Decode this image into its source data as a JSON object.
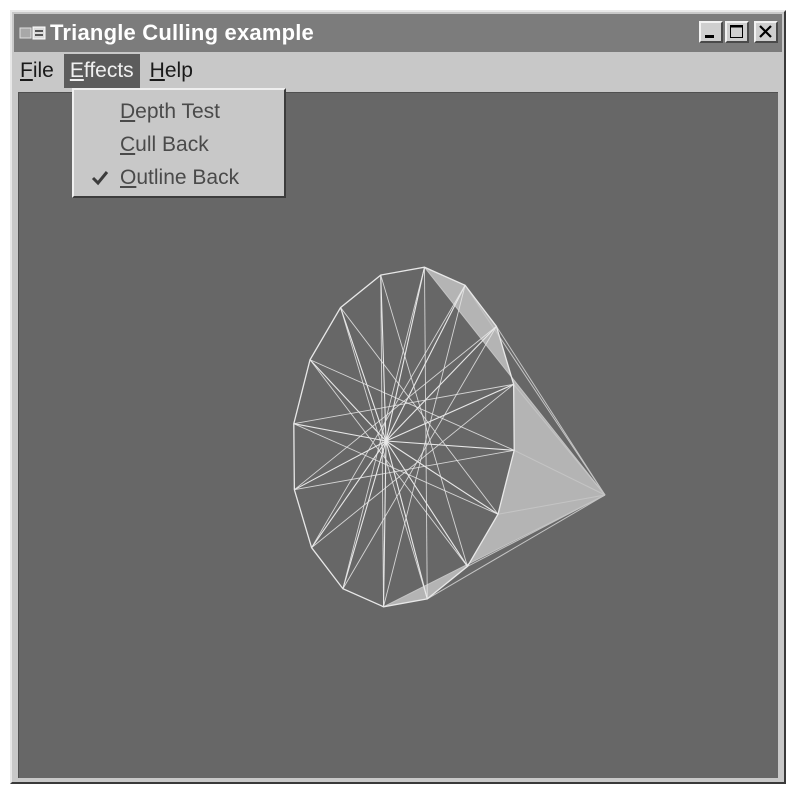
{
  "window": {
    "title": "Triangle Culling example",
    "icon": "app-window-icon",
    "controls": {
      "minimize": "minimize-icon",
      "maximize": "maximize-icon",
      "close": "close-icon"
    }
  },
  "menubar": {
    "items": [
      {
        "accel": "F",
        "rest": "ile"
      },
      {
        "accel": "E",
        "rest": "ffects"
      },
      {
        "accel": "H",
        "rest": "elp"
      }
    ],
    "open_index": 1
  },
  "effects_menu": {
    "items": [
      {
        "accel": "D",
        "rest": "epth Test",
        "checked": false
      },
      {
        "accel": "C",
        "rest": "ull Back",
        "checked": false
      },
      {
        "accel": "O",
        "rest": "utline Back",
        "checked": true
      }
    ],
    "check_icon": "checkmark-icon"
  },
  "scene": {
    "object": "wireframe-cone",
    "background": "#676767",
    "line_color": "#e8e8e8",
    "fill_color": "#b4b4b4"
  }
}
